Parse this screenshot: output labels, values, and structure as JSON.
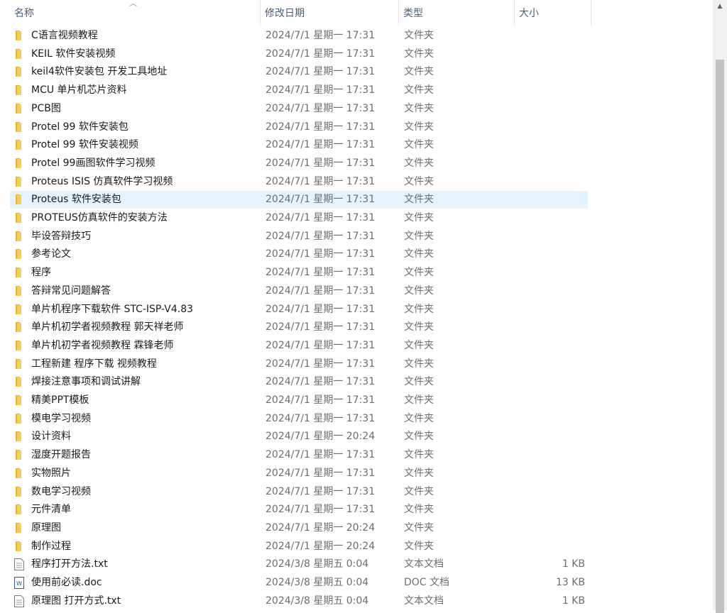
{
  "columns": {
    "name": "名称",
    "date": "修改日期",
    "type": "类型",
    "size": "大小"
  },
  "rows": [
    {
      "name": "C语言视频教程",
      "date": "2024/7/1 星期一 17:31",
      "type": "文件夹",
      "size": "",
      "icon": "folder"
    },
    {
      "name": "KEIL 软件安装视频",
      "date": "2024/7/1 星期一 17:31",
      "type": "文件夹",
      "size": "",
      "icon": "folder"
    },
    {
      "name": "keil4软件安装包 开发工具地址",
      "date": "2024/7/1 星期一 17:31",
      "type": "文件夹",
      "size": "",
      "icon": "folder"
    },
    {
      "name": "MCU 单片机芯片资料",
      "date": "2024/7/1 星期一 17:31",
      "type": "文件夹",
      "size": "",
      "icon": "folder"
    },
    {
      "name": "PCB图",
      "date": "2024/7/1 星期一 17:31",
      "type": "文件夹",
      "size": "",
      "icon": "folder"
    },
    {
      "name": "Protel 99 软件安装包",
      "date": "2024/7/1 星期一 17:31",
      "type": "文件夹",
      "size": "",
      "icon": "folder"
    },
    {
      "name": "Protel 99 软件安装视频",
      "date": "2024/7/1 星期一 17:31",
      "type": "文件夹",
      "size": "",
      "icon": "folder"
    },
    {
      "name": "Protel 99画图软件学习视频",
      "date": "2024/7/1 星期一 17:31",
      "type": "文件夹",
      "size": "",
      "icon": "folder"
    },
    {
      "name": "Proteus ISIS  仿真软件学习视频",
      "date": "2024/7/1 星期一 17:31",
      "type": "文件夹",
      "size": "",
      "icon": "folder"
    },
    {
      "name": "Proteus 软件安装包",
      "date": "2024/7/1 星期一 17:31",
      "type": "文件夹",
      "size": "",
      "icon": "folder",
      "selected": true
    },
    {
      "name": "PROTEUS仿真软件的安装方法",
      "date": "2024/7/1 星期一 17:31",
      "type": "文件夹",
      "size": "",
      "icon": "folder"
    },
    {
      "name": "毕设答辩技巧",
      "date": "2024/7/1 星期一 17:31",
      "type": "文件夹",
      "size": "",
      "icon": "folder"
    },
    {
      "name": "参考论文",
      "date": "2024/7/1 星期一 17:31",
      "type": "文件夹",
      "size": "",
      "icon": "folder"
    },
    {
      "name": "程序",
      "date": "2024/7/1 星期一 17:31",
      "type": "文件夹",
      "size": "",
      "icon": "folder"
    },
    {
      "name": "答辩常见问题解答",
      "date": "2024/7/1 星期一 17:31",
      "type": "文件夹",
      "size": "",
      "icon": "folder"
    },
    {
      "name": "单片机程序下载软件 STC-ISP-V4.83",
      "date": "2024/7/1 星期一 17:31",
      "type": "文件夹",
      "size": "",
      "icon": "folder"
    },
    {
      "name": "单片机初学者视频教程 郭天祥老师",
      "date": "2024/7/1 星期一 17:31",
      "type": "文件夹",
      "size": "",
      "icon": "folder"
    },
    {
      "name": "单片机初学者视频教程 霖锋老师",
      "date": "2024/7/1 星期一 17:31",
      "type": "文件夹",
      "size": "",
      "icon": "folder"
    },
    {
      "name": "工程新建  程序下载 视频教程",
      "date": "2024/7/1 星期一 17:31",
      "type": "文件夹",
      "size": "",
      "icon": "folder"
    },
    {
      "name": "焊接注意事项和调试讲解",
      "date": "2024/7/1 星期一 17:31",
      "type": "文件夹",
      "size": "",
      "icon": "folder"
    },
    {
      "name": "精美PPT模板",
      "date": "2024/7/1 星期一 17:31",
      "type": "文件夹",
      "size": "",
      "icon": "folder"
    },
    {
      "name": "模电学习视频",
      "date": "2024/7/1 星期一 17:31",
      "type": "文件夹",
      "size": "",
      "icon": "folder"
    },
    {
      "name": "设计资料",
      "date": "2024/7/1 星期一 20:24",
      "type": "文件夹",
      "size": "",
      "icon": "folder"
    },
    {
      "name": "湿度开题报告",
      "date": "2024/7/1 星期一 17:31",
      "type": "文件夹",
      "size": "",
      "icon": "folder"
    },
    {
      "name": "实物照片",
      "date": "2024/7/1 星期一 17:31",
      "type": "文件夹",
      "size": "",
      "icon": "folder"
    },
    {
      "name": "数电学习视频",
      "date": "2024/7/1 星期一 17:31",
      "type": "文件夹",
      "size": "",
      "icon": "folder"
    },
    {
      "name": "元件清单",
      "date": "2024/7/1 星期一 17:31",
      "type": "文件夹",
      "size": "",
      "icon": "folder"
    },
    {
      "name": "原理图",
      "date": "2024/7/1 星期一 20:24",
      "type": "文件夹",
      "size": "",
      "icon": "folder"
    },
    {
      "name": "制作过程",
      "date": "2024/7/1 星期一 20:24",
      "type": "文件夹",
      "size": "",
      "icon": "folder"
    },
    {
      "name": "程序打开方法.txt",
      "date": "2024/3/8 星期五 0:04",
      "type": "文本文档",
      "size": "1 KB",
      "icon": "text"
    },
    {
      "name": "使用前必读.doc",
      "date": "2024/3/8 星期五 0:04",
      "type": "DOC 文档",
      "size": "13 KB",
      "icon": "word"
    },
    {
      "name": "原理图 打开方式.txt",
      "date": "2024/3/8 星期五 0:04",
      "type": "文本文档",
      "size": "1 KB",
      "icon": "text"
    }
  ],
  "colors": {
    "selected_row": "#e5f3ff",
    "folder": "#f7cd5a",
    "header_text": "#4c607a"
  }
}
